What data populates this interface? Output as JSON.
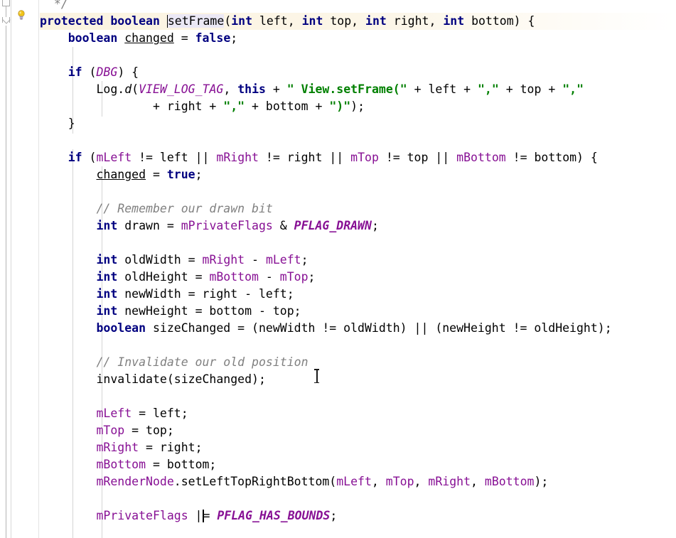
{
  "editor": {
    "language": "java",
    "theme": "IntelliJ Light",
    "colors": {
      "background": "#ffffff",
      "foreground": "#000000",
      "keyword": "#000080",
      "string": "#008000",
      "comment": "#808080",
      "field": "#871094",
      "static_constant": "#871094",
      "caret_row": "#fdf6e3",
      "gutter_border": "#d8d8d8",
      "indent_guide": "#d4d4d4"
    }
  },
  "gutter": {
    "intention_icon": "lightbulb-icon",
    "fold_markers": [
      "fold-region-marker",
      "fold-collapse-arrow"
    ]
  },
  "cursor": {
    "caret_line_index": 1,
    "caret_text_column_label": "setFrame",
    "mouse_pointer": "i-beam-text-cursor"
  },
  "code": {
    "lines": [
      {
        "indent": 0,
        "tokens": [
          {
            "t": "cmt",
            "s": "  */"
          }
        ]
      },
      {
        "indent": 0,
        "caret": true,
        "tokens": [
          {
            "t": "kw",
            "s": "protected"
          },
          {
            "t": "pln",
            "s": " "
          },
          {
            "t": "kw",
            "s": "boolean"
          },
          {
            "t": "pln",
            "s": " "
          },
          {
            "t": "caret",
            "s": ""
          },
          {
            "t": "sel",
            "s": "setFrame"
          },
          {
            "t": "pln",
            "s": "("
          },
          {
            "t": "kw",
            "s": "int"
          },
          {
            "t": "pln",
            "s": " left, "
          },
          {
            "t": "kw",
            "s": "int"
          },
          {
            "t": "pln",
            "s": " top, "
          },
          {
            "t": "kw",
            "s": "int"
          },
          {
            "t": "pln",
            "s": " right, "
          },
          {
            "t": "kw",
            "s": "int"
          },
          {
            "t": "pln",
            "s": " bottom) {"
          }
        ]
      },
      {
        "indent": 1,
        "tokens": [
          {
            "t": "kw",
            "s": "boolean"
          },
          {
            "t": "pln",
            "s": " "
          },
          {
            "t": "lvar",
            "s": "changed"
          },
          {
            "t": "pln",
            "s": " = "
          },
          {
            "t": "kw",
            "s": "false"
          },
          {
            "t": "pln",
            "s": ";"
          }
        ]
      },
      {
        "indent": 0,
        "tokens": []
      },
      {
        "indent": 1,
        "tokens": [
          {
            "t": "kw",
            "s": "if"
          },
          {
            "t": "pln",
            "s": " ("
          },
          {
            "t": "cst",
            "s": "DBG"
          },
          {
            "t": "pln",
            "s": ") {"
          }
        ]
      },
      {
        "indent": 2,
        "tokens": [
          {
            "t": "pln",
            "s": "Log."
          },
          {
            "t": "ital",
            "s": "d"
          },
          {
            "t": "pln",
            "s": "("
          },
          {
            "t": "cst",
            "s": "VIEW_LOG_TAG"
          },
          {
            "t": "pln",
            "s": ", "
          },
          {
            "t": "kw",
            "s": "this"
          },
          {
            "t": "pln",
            "s": " + "
          },
          {
            "t": "str",
            "s": "\" View.setFrame(\""
          },
          {
            "t": "pln",
            "s": " + left + "
          },
          {
            "t": "str",
            "s": "\",\""
          },
          {
            "t": "pln",
            "s": " + top + "
          },
          {
            "t": "str",
            "s": "\",\""
          }
        ]
      },
      {
        "indent": 4,
        "tokens": [
          {
            "t": "pln",
            "s": "+ right + "
          },
          {
            "t": "str",
            "s": "\",\""
          },
          {
            "t": "pln",
            "s": " + bottom + "
          },
          {
            "t": "str",
            "s": "\")\""
          },
          {
            "t": "pln",
            "s": ");"
          }
        ]
      },
      {
        "indent": 1,
        "tokens": [
          {
            "t": "pln",
            "s": "}"
          }
        ]
      },
      {
        "indent": 0,
        "tokens": []
      },
      {
        "indent": 1,
        "tokens": [
          {
            "t": "kw",
            "s": "if"
          },
          {
            "t": "pln",
            "s": " ("
          },
          {
            "t": "fld",
            "s": "mLeft"
          },
          {
            "t": "pln",
            "s": " != left || "
          },
          {
            "t": "fld",
            "s": "mRight"
          },
          {
            "t": "pln",
            "s": " != right || "
          },
          {
            "t": "fld",
            "s": "mTop"
          },
          {
            "t": "pln",
            "s": " != top || "
          },
          {
            "t": "fld",
            "s": "mBottom"
          },
          {
            "t": "pln",
            "s": " != bottom) {"
          }
        ]
      },
      {
        "indent": 2,
        "tokens": [
          {
            "t": "lvar",
            "s": "changed"
          },
          {
            "t": "pln",
            "s": " = "
          },
          {
            "t": "kw",
            "s": "true"
          },
          {
            "t": "pln",
            "s": ";"
          }
        ]
      },
      {
        "indent": 0,
        "tokens": []
      },
      {
        "indent": 2,
        "tokens": [
          {
            "t": "cmt",
            "s": "// Remember our drawn bit"
          }
        ]
      },
      {
        "indent": 2,
        "tokens": [
          {
            "t": "kw",
            "s": "int"
          },
          {
            "t": "pln",
            "s": " drawn = "
          },
          {
            "t": "fld",
            "s": "mPrivateFlags"
          },
          {
            "t": "pln",
            "s": " & "
          },
          {
            "t": "cstb",
            "s": "PFLAG_DRAWN"
          },
          {
            "t": "pln",
            "s": ";"
          }
        ]
      },
      {
        "indent": 0,
        "tokens": []
      },
      {
        "indent": 2,
        "tokens": [
          {
            "t": "kw",
            "s": "int"
          },
          {
            "t": "pln",
            "s": " oldWidth = "
          },
          {
            "t": "fld",
            "s": "mRight"
          },
          {
            "t": "pln",
            "s": " - "
          },
          {
            "t": "fld",
            "s": "mLeft"
          },
          {
            "t": "pln",
            "s": ";"
          }
        ]
      },
      {
        "indent": 2,
        "tokens": [
          {
            "t": "kw",
            "s": "int"
          },
          {
            "t": "pln",
            "s": " oldHeight = "
          },
          {
            "t": "fld",
            "s": "mBottom"
          },
          {
            "t": "pln",
            "s": " - "
          },
          {
            "t": "fld",
            "s": "mTop"
          },
          {
            "t": "pln",
            "s": ";"
          }
        ]
      },
      {
        "indent": 2,
        "tokens": [
          {
            "t": "kw",
            "s": "int"
          },
          {
            "t": "pln",
            "s": " newWidth = right - left;"
          }
        ]
      },
      {
        "indent": 2,
        "tokens": [
          {
            "t": "kw",
            "s": "int"
          },
          {
            "t": "pln",
            "s": " newHeight = bottom - top;"
          }
        ]
      },
      {
        "indent": 2,
        "tokens": [
          {
            "t": "kw",
            "s": "boolean"
          },
          {
            "t": "pln",
            "s": " sizeChanged = (newWidth != oldWidth) || (newHeight != oldHeight);"
          }
        ]
      },
      {
        "indent": 0,
        "tokens": []
      },
      {
        "indent": 2,
        "tokens": [
          {
            "t": "cmt",
            "s": "// Invalidate our old position"
          }
        ]
      },
      {
        "indent": 2,
        "tokens": [
          {
            "t": "pln",
            "s": "invalidate(sizeChanged);"
          }
        ]
      },
      {
        "indent": 0,
        "tokens": []
      },
      {
        "indent": 2,
        "tokens": [
          {
            "t": "fld",
            "s": "mLeft"
          },
          {
            "t": "pln",
            "s": " = left;"
          }
        ]
      },
      {
        "indent": 2,
        "tokens": [
          {
            "t": "fld",
            "s": "mTop"
          },
          {
            "t": "pln",
            "s": " = top;"
          }
        ]
      },
      {
        "indent": 2,
        "tokens": [
          {
            "t": "fld",
            "s": "mRight"
          },
          {
            "t": "pln",
            "s": " = right;"
          }
        ]
      },
      {
        "indent": 2,
        "tokens": [
          {
            "t": "fld",
            "s": "mBottom"
          },
          {
            "t": "pln",
            "s": " = bottom;"
          }
        ]
      },
      {
        "indent": 2,
        "tokens": [
          {
            "t": "fld",
            "s": "mRenderNode"
          },
          {
            "t": "pln",
            "s": ".setLeftTopRightBottom("
          },
          {
            "t": "fld",
            "s": "mLeft"
          },
          {
            "t": "pln",
            "s": ", "
          },
          {
            "t": "fld",
            "s": "mTop"
          },
          {
            "t": "pln",
            "s": ", "
          },
          {
            "t": "fld",
            "s": "mRight"
          },
          {
            "t": "pln",
            "s": ", "
          },
          {
            "t": "fld",
            "s": "mBottom"
          },
          {
            "t": "pln",
            "s": ");"
          }
        ]
      },
      {
        "indent": 0,
        "tokens": []
      },
      {
        "indent": 2,
        "tokens": [
          {
            "t": "fld",
            "s": "mPrivateFlags"
          },
          {
            "t": "pln",
            "s": " |"
          },
          {
            "t": "caret",
            "s": ""
          },
          {
            "t": "pln",
            "s": "= "
          },
          {
            "t": "cstb",
            "s": "PFLAG_HAS_BOUNDS"
          },
          {
            "t": "pln",
            "s": ";"
          }
        ]
      }
    ]
  }
}
